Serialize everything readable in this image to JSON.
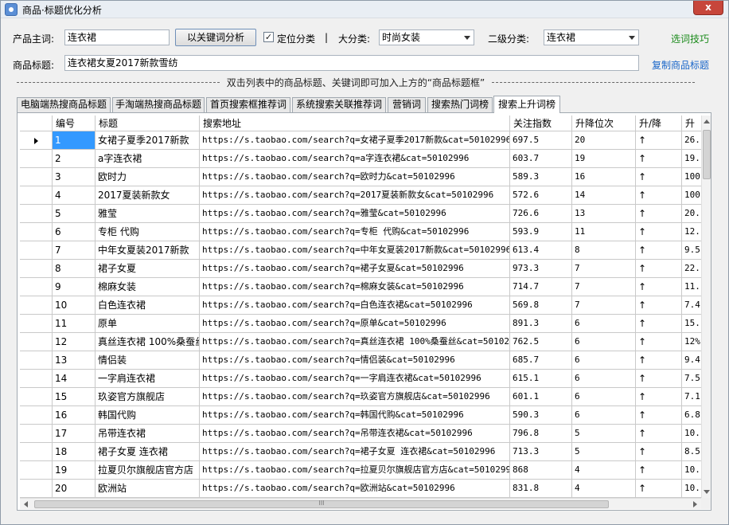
{
  "window": {
    "title": "商品·标题优化分析",
    "close_label": "x"
  },
  "toolbar": {
    "keyword_label": "产品主词:",
    "keyword_value": "连衣裙",
    "analyze_button": "以关键词分析",
    "locate_category_label": "定位分类",
    "locate_category_checked": true,
    "separator": "|",
    "category_label": "大分类:",
    "category_value": "时尚女装",
    "subcategory_label": "二级分类:",
    "subcategory_value": "连衣裙",
    "tips_link": "选词技巧",
    "title_label": "商品标题:",
    "title_value": "连衣裙女夏2017新款雪纺",
    "copy_title_link": "复制商品标题"
  },
  "hint": "双击列表中的商品标题、关键词即可加入上方的“商品标题框”",
  "tabs": [
    {
      "label": "电脑端热搜商品标题",
      "active": false
    },
    {
      "label": "手淘端热搜商品标题",
      "active": false
    },
    {
      "label": "首页搜索框推荐词",
      "active": false
    },
    {
      "label": "系统搜索关联推荐词",
      "active": false
    },
    {
      "label": "营销词",
      "active": false
    },
    {
      "label": "搜索热门词榜",
      "active": false
    },
    {
      "label": "搜索上升词榜",
      "active": true
    }
  ],
  "table": {
    "columns": [
      "编号",
      "标题",
      "搜索地址",
      "关注指数",
      "升降位次",
      "升/降",
      "升"
    ],
    "rows": [
      {
        "id": "1",
        "title": "女裙子夏季2017新款",
        "url": "https://s.taobao.com/search?q=女裙子夏季2017新款&cat=50102996",
        "index": "697.5",
        "rank": "20",
        "dir": "↑",
        "pct": "26."
      },
      {
        "id": "2",
        "title": "a字连衣裙",
        "url": "https://s.taobao.com/search?q=a字连衣裙&cat=50102996",
        "index": "603.7",
        "rank": "19",
        "dir": "↑",
        "pct": "19."
      },
      {
        "id": "3",
        "title": "欧时力",
        "url": "https://s.taobao.com/search?q=欧时力&cat=50102996",
        "index": "589.3",
        "rank": "16",
        "dir": "↑",
        "pct": "100"
      },
      {
        "id": "4",
        "title": "2017夏装新款女",
        "url": "https://s.taobao.com/search?q=2017夏装新款女&cat=50102996",
        "index": "572.6",
        "rank": "14",
        "dir": "↑",
        "pct": "100"
      },
      {
        "id": "5",
        "title": "雅莹",
        "url": "https://s.taobao.com/search?q=雅莹&cat=50102996",
        "index": "726.6",
        "rank": "13",
        "dir": "↑",
        "pct": "20."
      },
      {
        "id": "6",
        "title": "专柜 代购",
        "url": "https://s.taobao.com/search?q=专柜 代购&cat=50102996",
        "index": "593.9",
        "rank": "11",
        "dir": "↑",
        "pct": "12."
      },
      {
        "id": "7",
        "title": "中年女夏装2017新款",
        "url": "https://s.taobao.com/search?q=中年女夏装2017新款&cat=50102996",
        "index": "613.4",
        "rank": "8",
        "dir": "↑",
        "pct": "9.5"
      },
      {
        "id": "8",
        "title": "裙子女夏",
        "url": "https://s.taobao.com/search?q=裙子女夏&cat=50102996",
        "index": "973.3",
        "rank": "7",
        "dir": "↑",
        "pct": "22."
      },
      {
        "id": "9",
        "title": "棉麻女装",
        "url": "https://s.taobao.com/search?q=棉麻女装&cat=50102996",
        "index": "714.7",
        "rank": "7",
        "dir": "↑",
        "pct": "11."
      },
      {
        "id": "10",
        "title": "白色连衣裙",
        "url": "https://s.taobao.com/search?q=白色连衣裙&cat=50102996",
        "index": "569.8",
        "rank": "7",
        "dir": "↑",
        "pct": "7.4"
      },
      {
        "id": "11",
        "title": "原单",
        "url": "https://s.taobao.com/search?q=原单&cat=50102996",
        "index": "891.3",
        "rank": "6",
        "dir": "↑",
        "pct": "15."
      },
      {
        "id": "12",
        "title": "真丝连衣裙 100%桑蚕丝",
        "url": "https://s.taobao.com/search?q=真丝连衣裙 100%桑蚕丝&cat=50102996",
        "index": "762.5",
        "rank": "6",
        "dir": "↑",
        "pct": "12%"
      },
      {
        "id": "13",
        "title": "情侣装",
        "url": "https://s.taobao.com/search?q=情侣装&cat=50102996",
        "index": "685.7",
        "rank": "6",
        "dir": "↑",
        "pct": "9.4"
      },
      {
        "id": "14",
        "title": "一字肩连衣裙",
        "url": "https://s.taobao.com/search?q=一字肩连衣裙&cat=50102996",
        "index": "615.1",
        "rank": "6",
        "dir": "↑",
        "pct": "7.5"
      },
      {
        "id": "15",
        "title": "玖姿官方旗舰店",
        "url": "https://s.taobao.com/search?q=玖姿官方旗舰店&cat=50102996",
        "index": "601.1",
        "rank": "6",
        "dir": "↑",
        "pct": "7.1"
      },
      {
        "id": "16",
        "title": "韩国代购",
        "url": "https://s.taobao.com/search?q=韩国代购&cat=50102996",
        "index": "590.3",
        "rank": "6",
        "dir": "↑",
        "pct": "6.8"
      },
      {
        "id": "17",
        "title": "吊带连衣裙",
        "url": "https://s.taobao.com/search?q=吊带连衣裙&cat=50102996",
        "index": "796.8",
        "rank": "5",
        "dir": "↑",
        "pct": "10."
      },
      {
        "id": "18",
        "title": "裙子女夏 连衣裙",
        "url": "https://s.taobao.com/search?q=裙子女夏 连衣裙&cat=50102996",
        "index": "713.3",
        "rank": "5",
        "dir": "↑",
        "pct": "8.5"
      },
      {
        "id": "19",
        "title": "拉夏贝尔旗舰店官方店",
        "url": "https://s.taobao.com/search?q=拉夏贝尔旗舰店官方店&cat=50102996",
        "index": "868",
        "rank": "4",
        "dir": "↑",
        "pct": "10."
      },
      {
        "id": "20",
        "title": "欧洲站",
        "url": "https://s.taobao.com/search?q=欧洲站&cat=50102996",
        "index": "831.8",
        "rank": "4",
        "dir": "↑",
        "pct": "10."
      }
    ]
  },
  "scrollbar": {
    "grip": "III"
  },
  "colors": {
    "selection": "#3399ff",
    "tips_link": "#1a8a1a",
    "copy_link": "#1a66c9",
    "close_button": "#c7463b"
  }
}
